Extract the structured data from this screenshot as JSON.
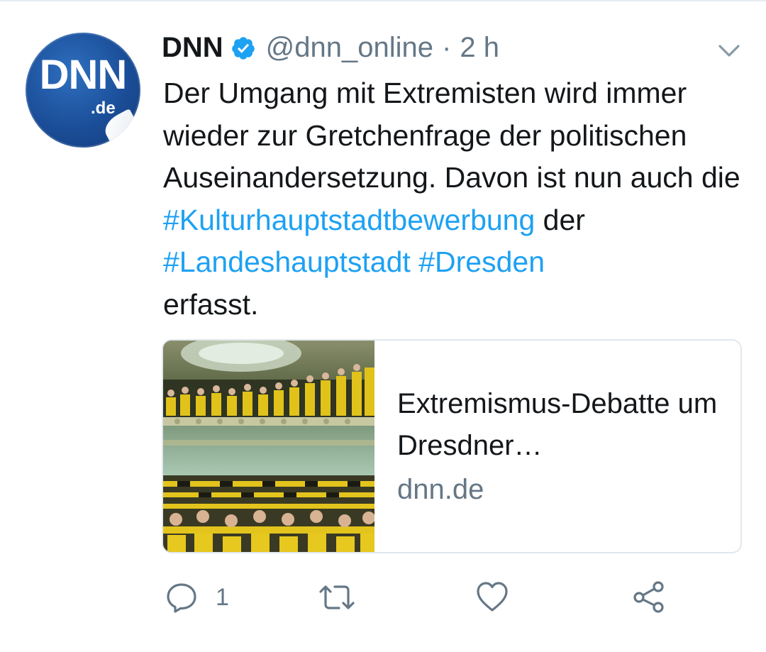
{
  "author": {
    "name": "DNN",
    "handle": "@dnn_online",
    "separator": "·",
    "time": "2 h",
    "avatar_text": "DNN",
    "avatar_subtext": ".de",
    "verified_icon": "verified-badge-icon"
  },
  "tweet": {
    "segments": [
      {
        "text": "Der Umgang mit Extremisten wird immer wieder zur Gretchenfrage der politischen Auseinandersetzung. Davon ist nun auch die ",
        "type": "text"
      },
      {
        "text": "#Kulturhauptstadtbewerbung",
        "type": "hashtag"
      },
      {
        "text": " der ",
        "type": "text"
      },
      {
        "text": "#Landeshauptstadt",
        "type": "hashtag"
      },
      {
        "text": " ",
        "type": "text"
      },
      {
        "text": "#Dresden",
        "type": "hashtag"
      },
      {
        "text": " erfasst.",
        "type": "text"
      }
    ]
  },
  "card": {
    "title": "Extremismus-Debatte um Dresdner…",
    "domain": "dnn.de"
  },
  "actions": {
    "reply_count": "1",
    "reply_icon": "reply-icon",
    "retweet_icon": "retweet-icon",
    "like_icon": "heart-icon",
    "share_icon": "share-icon"
  },
  "colors": {
    "hashtag": "#1da1f2",
    "secondary_text": "#657786",
    "verified": "#1da1f2",
    "avatar_bg": "#1b4e98"
  }
}
